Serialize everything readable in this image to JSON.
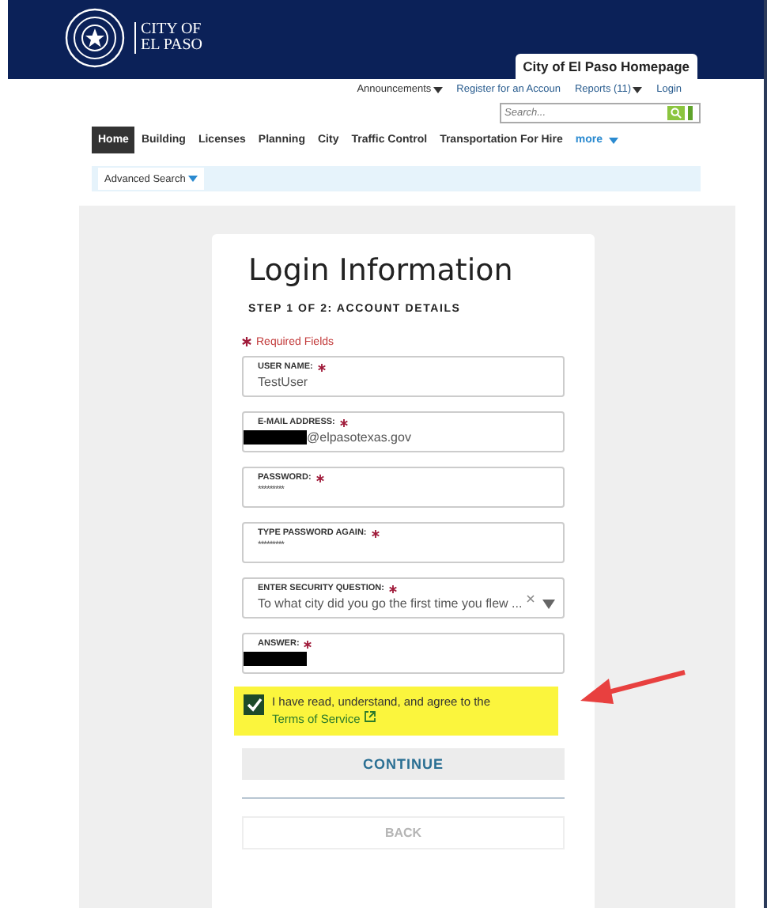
{
  "header": {
    "logo_text": [
      "CITY OF",
      "EL PASO"
    ],
    "homepage_tab": "City of El Paso Homepage"
  },
  "top_links": [
    {
      "label": "Announcements",
      "dropdown": true
    },
    {
      "label": "Register for an Accoun",
      "dropdown": false
    },
    {
      "label": "Reports (11)",
      "dropdown": true
    },
    {
      "label": "Login",
      "dropdown": false
    }
  ],
  "search": {
    "placeholder": "Search..."
  },
  "nav": [
    {
      "label": "Home",
      "selected": true
    },
    {
      "label": "Building",
      "selected": false
    },
    {
      "label": "Licenses",
      "selected": false
    },
    {
      "label": "Planning",
      "selected": false
    },
    {
      "label": "City",
      "selected": false
    },
    {
      "label": "Traffic Control",
      "selected": false
    },
    {
      "label": "Transportation For Hire",
      "selected": false
    },
    {
      "label": "more",
      "selected": false,
      "dropdown": true
    }
  ],
  "subnav": {
    "label": "Advanced Search"
  },
  "form": {
    "title": "Login Information",
    "step": "STEP 1 OF 2: ACCOUNT DETAILS",
    "required_note": "Required Fields",
    "fields": [
      {
        "kind": "text",
        "label": "USER NAME:",
        "value": "TestUser",
        "redacted": false
      },
      {
        "kind": "text",
        "label": "E-MAIL ADDRESS:",
        "value": "@elpasotexas.gov",
        "redacted": true
      },
      {
        "kind": "password",
        "label": "PASSWORD:",
        "value": "*********",
        "redacted": false
      },
      {
        "kind": "password",
        "label": "TYPE PASSWORD AGAIN:",
        "value": "*********",
        "redacted": false
      },
      {
        "kind": "select",
        "label": "ENTER SECURITY QUESTION:",
        "value": "To what city did you go the first time you flew ...",
        "redacted": false
      },
      {
        "kind": "text",
        "label": "ANSWER:",
        "redacted": true
      }
    ],
    "agree": {
      "checked": true,
      "text": "I have read, understand, and agree to the",
      "link": "Terms of Service"
    },
    "continue": "CONTINUE",
    "back": "BACK"
  }
}
